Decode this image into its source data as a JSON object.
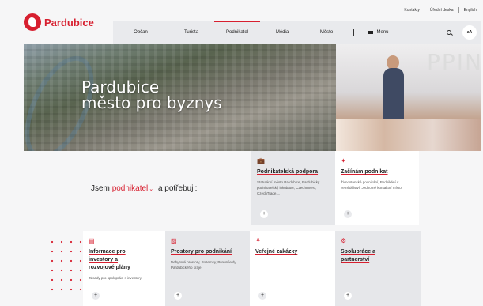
{
  "utility_links": [
    "Kontakty",
    "Úřední deska",
    "English"
  ],
  "logo": {
    "text": "Pardubice"
  },
  "nav": {
    "items": [
      "Občan",
      "Turista",
      "Podnikatel",
      "Média",
      "Město"
    ],
    "active": "Podnikatel",
    "menu_label": "Menu",
    "font_toggle": "aA"
  },
  "hero": {
    "title_line1": "Pardubice",
    "title_line2": "město pro byznys",
    "photo_sign": "PPIN"
  },
  "iam": {
    "prefix": "Jsem",
    "role": "podnikatel",
    "suffix": "a potřebuji:"
  },
  "cards": [
    {
      "title": "Podnikatelská podpora",
      "desc": "Statutární město Pardubice, Pardubický podnikatelský inkubátor, CzechInvest, CzechTrade,..."
    },
    {
      "title": "Začínám podnikat",
      "desc": "Živnostenské podnikání, Podnikání v zemědělství, Jednotné kontaktní místo"
    },
    {
      "title": "Informace pro investory a rozvojové plány",
      "desc": "Zásady pro spolupráci s investory"
    },
    {
      "title": "Prostory pro podnikání",
      "desc": "Nebytové prostory, Pozemky, Brownfieldy Pardubického kraje"
    },
    {
      "title": "Veřejné zakázky",
      "desc": ""
    },
    {
      "title": "Spolupráce a partnerství",
      "desc": ""
    }
  ],
  "accent_color": "#d71f2f"
}
